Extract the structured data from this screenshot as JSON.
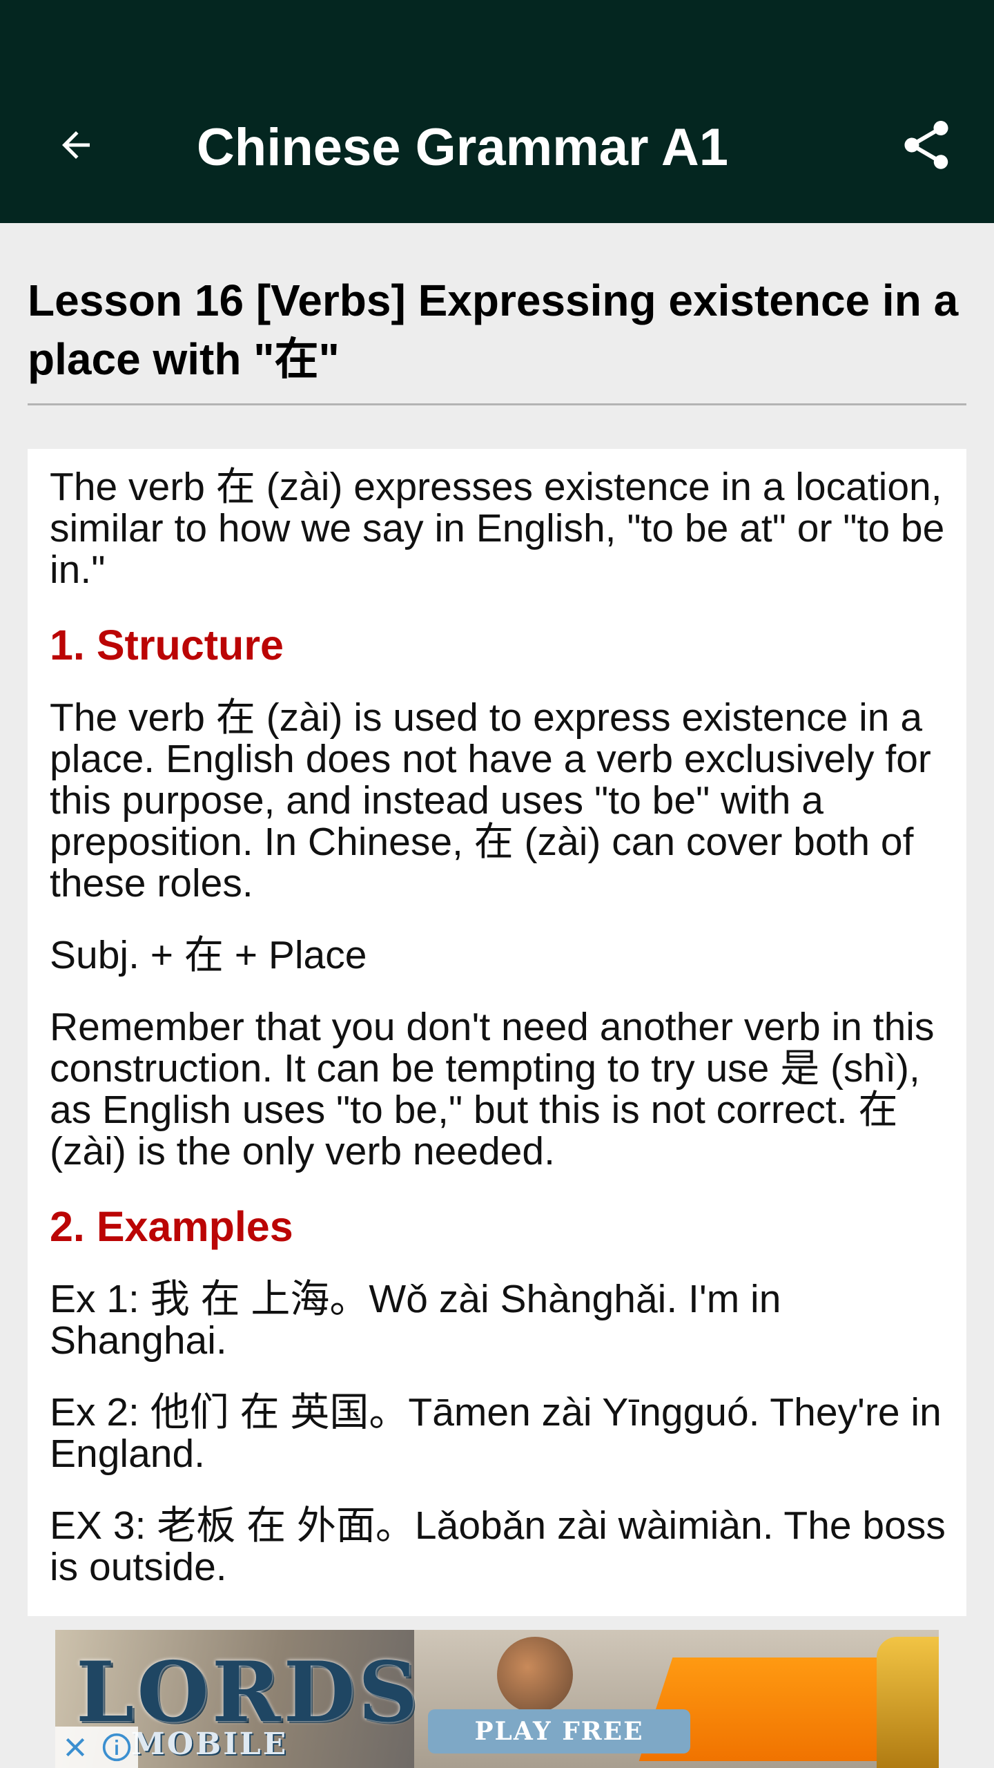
{
  "appbar": {
    "title": "Chinese Grammar A1",
    "back_icon": "arrow-back-icon",
    "share_icon": "share-icon",
    "background": "#042620"
  },
  "lesson": {
    "title": "Lesson 16 [Verbs] Expressing existence in a place with \"在\"",
    "intro": "The verb 在 (zài) expresses existence in a location, similar to how we say in English, \"to be at\" or \"to be in.\"",
    "section1_heading": "1. Structure",
    "structure_text": "The verb 在 (zài) is used to express existence in a place. English does not have a verb exclusively for this purpose, and instead uses \"to be\" with a preposition. In Chinese, 在 (zài) can cover both of these roles.",
    "pattern": "Subj. + 在 + Place",
    "reminder": "Remember that you don't need another verb in this construction. It can be tempting to try use 是 (shì), as English uses \"to be,\" but this is not correct. 在 (zài) is the only verb needed.",
    "section2_heading": "2. Examples",
    "examples": [
      "Ex 1: 我 在 上海。Wǒ zài Shànghǎi. I'm in Shanghai.",
      "Ex 2: 他们 在 英国。Tāmen zài Yīngguó. They're in England.",
      "EX 3: 老板 在 外面。Lǎobǎn zài wàimiàn. The boss is outside."
    ],
    "heading_color": "#bb0505"
  },
  "ad": {
    "logo_text": "LORDS",
    "logo_sub": "MOBILE",
    "cta": "PLAY FREE",
    "close_icon": "close-icon",
    "info_icon": "info-icon"
  }
}
